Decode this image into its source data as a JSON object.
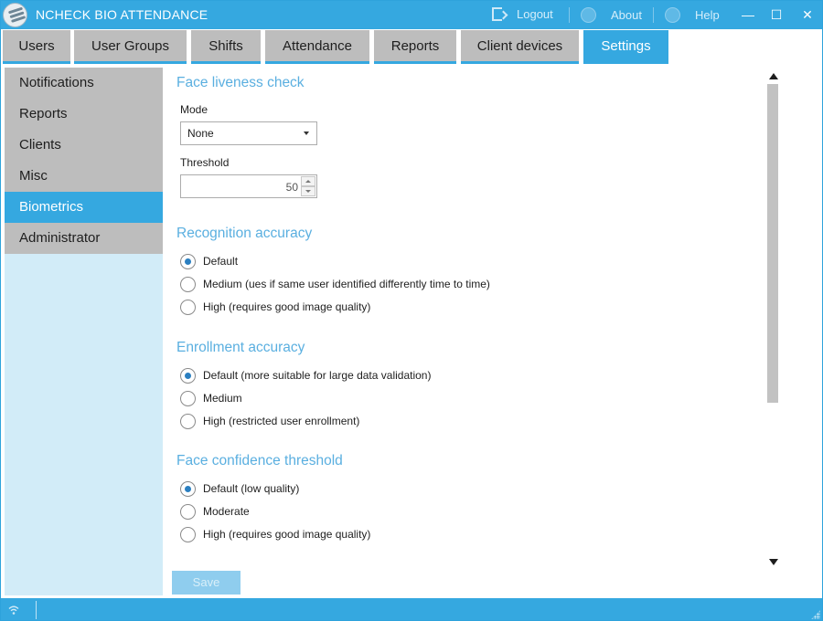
{
  "window": {
    "title": "NCHECK BIO ATTENDANCE",
    "logout_label": "Logout",
    "about_label": "About",
    "help_label": "Help",
    "minimize": "—",
    "maximize": "☐",
    "close": "✕",
    "logo_icon": "ncheck-fingerprint-logo"
  },
  "tabs": [
    {
      "label": "Users"
    },
    {
      "label": "User Groups"
    },
    {
      "label": "Shifts"
    },
    {
      "label": "Attendance"
    },
    {
      "label": "Reports"
    },
    {
      "label": "Client devices"
    },
    {
      "label": "Settings"
    }
  ],
  "active_tab": "Settings",
  "sidebar": {
    "items": [
      {
        "label": "Notifications"
      },
      {
        "label": "Reports"
      },
      {
        "label": "Clients"
      },
      {
        "label": "Misc"
      },
      {
        "label": "Biometrics"
      },
      {
        "label": "Administrator"
      }
    ],
    "active": "Biometrics"
  },
  "liveness": {
    "title": "Face liveness check",
    "mode_label": "Mode",
    "mode_value": "None",
    "threshold_label": "Threshold",
    "threshold_value": "50"
  },
  "recognition": {
    "title": "Recognition accuracy",
    "options": [
      {
        "label": "Default",
        "checked": true
      },
      {
        "label": "Medium (ues if same user identified differently time to time)",
        "checked": false
      },
      {
        "label": "High (requires good image quality)",
        "checked": false
      }
    ]
  },
  "enrollment": {
    "title": "Enrollment accuracy",
    "options": [
      {
        "label": "Default (more suitable for large data validation)",
        "checked": true
      },
      {
        "label": "Medium",
        "checked": false
      },
      {
        "label": "High (restricted user enrollment)",
        "checked": false
      }
    ]
  },
  "confidence": {
    "title": "Face confidence threshold",
    "options": [
      {
        "label": "Default (low quality)",
        "checked": true
      },
      {
        "label": "Moderate",
        "checked": false
      },
      {
        "label": "High (requires good image quality)",
        "checked": false
      }
    ]
  },
  "save_label": "Save",
  "colors": {
    "accent": "#35a8e0",
    "section_title": "#5aafe0",
    "tab_inactive": "#bdbdbd",
    "sidebar_bg": "#d2ecf8",
    "radio_dot": "#2b7fc0"
  }
}
